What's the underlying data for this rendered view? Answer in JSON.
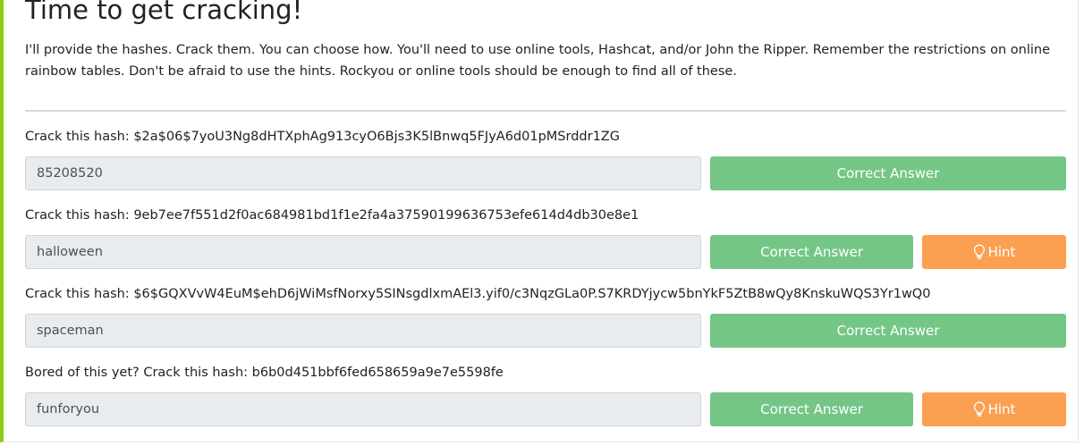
{
  "page": {
    "title": "Time to get cracking!",
    "intro": "I'll provide the hashes. Crack them. You can choose how. You'll need to use online tools, Hashcat, and/or John the Ripper. Remember the restrictions on online rainbow tables. Don't be afraid to use the hints. Rockyou or online tools should be enough to find all of these."
  },
  "questions": [
    {
      "label": "Crack this hash: $2a$06$7yoU3Ng8dHTXphAg913cyO6Bjs3K5lBnwq5FJyA6d01pMSrddr1ZG",
      "answer": "85208520",
      "button": "Correct Answer"
    },
    {
      "label": "Crack this hash: 9eb7ee7f551d2f0ac684981bd1f1e2fa4a37590199636753efe614d4db30e8e1",
      "answer": "halloween",
      "button": "Correct Answer",
      "hint": "Hint"
    },
    {
      "label": "Crack this hash: $6$GQXVvW4EuM$ehD6jWiMsfNorxy5SINsgdlxmAEl3.yif0/c3NqzGLa0P.S7KRDYjycw5bnYkF5ZtB8wQy8KnskuWQS3Yr1wQ0",
      "answer": "spaceman",
      "button": "Correct Answer"
    },
    {
      "label": "Bored of this yet? Crack this hash: b6b0d451bbf6fed658659a9e7e5598fe",
      "answer": "funforyou",
      "button": "Correct Answer",
      "hint": "Hint"
    }
  ],
  "colors": {
    "accent_border": "#88cc14",
    "correct_button": "#74c686",
    "hint_button": "#fb9f50",
    "input_background": "#e9ecef"
  },
  "icons": {
    "hint": "lightbulb-icon"
  }
}
